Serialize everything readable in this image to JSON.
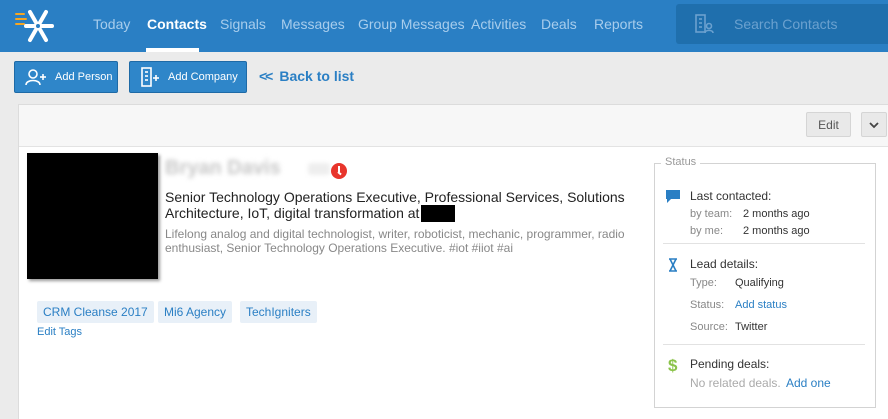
{
  "nav": {
    "items": [
      "Today",
      "Contacts",
      "Signals",
      "Messages",
      "Group Messages",
      "Activities",
      "Deals",
      "Reports"
    ],
    "active": "Contacts",
    "search_placeholder": "Search Contacts"
  },
  "actions": {
    "add_person": "Add Person",
    "add_company": "Add Company",
    "back_to_list": "Back to list"
  },
  "card": {
    "edit_label": "Edit"
  },
  "person": {
    "name": "Bryan Davis",
    "headline": "Senior Technology Operations Executive, Professional Services, Solutions Architecture, IoT, digital transformation at",
    "bio": "Lifelong analog and digital technologist, writer, roboticist, mechanic, programmer, radio enthusiast, Senior Technology Operations Executive. #iot #iiot #ai"
  },
  "tags": [
    "CRM Cleanse 2017",
    "Mi6 Agency",
    "TechIgniters"
  ],
  "edit_tags_label": "Edit Tags",
  "status": {
    "legend": "Status",
    "last_contacted": {
      "title": "Last contacted:",
      "by_team_label": "by team:",
      "by_team_value": "2 months ago",
      "by_me_label": "by me:",
      "by_me_value": "2 months ago"
    },
    "lead_details": {
      "title": "Lead details:",
      "type_label": "Type:",
      "type_value": "Qualifying",
      "status_label": "Status:",
      "status_value": "Add status",
      "source_label": "Source:",
      "source_value": "Twitter"
    },
    "pending_deals": {
      "title": "Pending deals:",
      "empty_text": "No related deals.",
      "add_link": "Add one"
    }
  },
  "colors": {
    "nav_bg": "#2a7fc4",
    "accent": "#2a7fc4",
    "alert": "#e8352c",
    "deal_icon": "#8bc34a"
  }
}
